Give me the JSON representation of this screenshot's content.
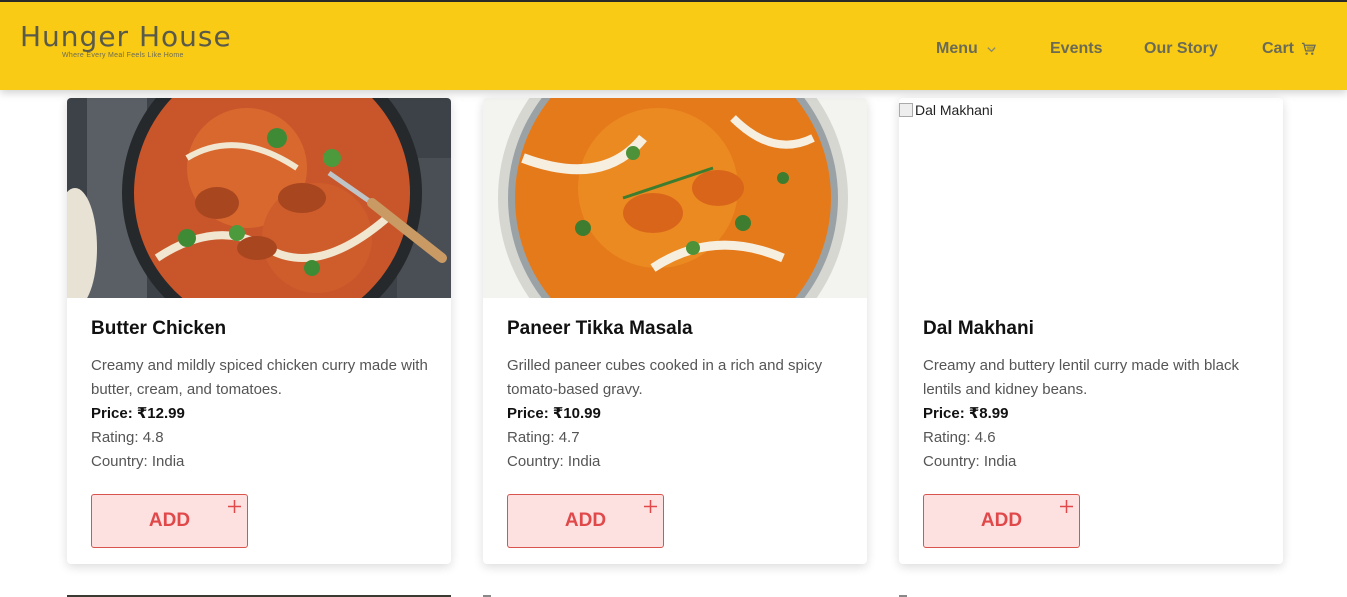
{
  "brand": {
    "title": "Hunger House",
    "tagline": "Where Every Meal Feels Like Home"
  },
  "nav": {
    "menu": "Menu",
    "events": "Events",
    "story": "Our Story",
    "cart": "Cart"
  },
  "colors": {
    "header": "#f9cb15",
    "accent": "#e0484a",
    "button_bg": "#fde0e0"
  },
  "cards": [
    {
      "title": "Butter Chicken",
      "desc": "Creamy and mildly spiced chicken curry made with butter, cream, and tomatoes.",
      "price": "Price: ₹12.99",
      "rating": "Rating: 4.8",
      "country": "Country: India",
      "add": "ADD"
    },
    {
      "title": "Paneer Tikka Masala",
      "desc": "Grilled paneer cubes cooked in a rich and spicy tomato-based gravy.",
      "price": "Price: ₹10.99",
      "rating": "Rating: 4.7",
      "country": "Country: India",
      "add": "ADD"
    },
    {
      "title": "Dal Makhani",
      "desc": "Creamy and buttery lentil curry made with black lentils and kidney beans.",
      "price": "Price: ₹8.99",
      "rating": "Rating: 4.6",
      "country": "Country: India",
      "add": "ADD",
      "img_alt": "Dal Makhani"
    }
  ]
}
